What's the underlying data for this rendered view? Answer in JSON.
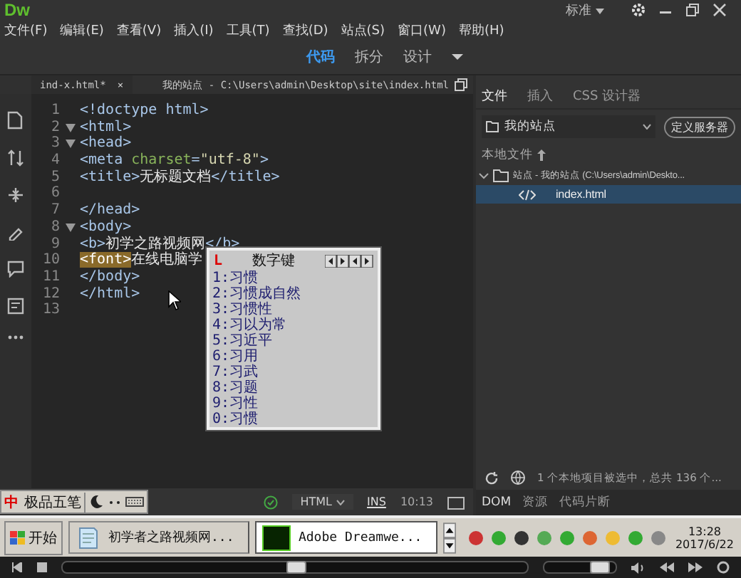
{
  "app": {
    "logo": "Dw",
    "workspace": "标准"
  },
  "menu": [
    "文件(F)",
    "编辑(E)",
    "查看(V)",
    "插入(I)",
    "工具(T)",
    "查找(D)",
    "站点(S)",
    "窗口(W)",
    "帮助(H)"
  ],
  "view_tabs": [
    {
      "label": "代码",
      "selected": true
    },
    {
      "label": "拆分",
      "selected": false
    },
    {
      "label": "设计",
      "selected": false
    }
  ],
  "document": {
    "tab": "ind-x.html*",
    "close": "×",
    "path": "我的站点 - C:\\Users\\admin\\Desktop\\site\\index.html"
  },
  "code_lines": [
    {
      "number": "1",
      "fold": false,
      "tokens": [
        {
          "kind": "tag",
          "text": "<!doctype html>"
        }
      ]
    },
    {
      "number": "2",
      "fold": true,
      "tokens": [
        {
          "kind": "tag",
          "text": "<html>"
        }
      ]
    },
    {
      "number": "3",
      "fold": true,
      "tokens": [
        {
          "kind": "tag",
          "text": "<head>"
        }
      ]
    },
    {
      "number": "4",
      "fold": false,
      "tokens": [
        {
          "kind": "tag",
          "text": "<meta "
        },
        {
          "kind": "attr",
          "text": "charset"
        },
        {
          "kind": "tag",
          "text": "="
        },
        {
          "kind": "string",
          "text": "\"utf-8\""
        },
        {
          "kind": "tag",
          "text": ">"
        }
      ]
    },
    {
      "number": "5",
      "fold": false,
      "tokens": [
        {
          "kind": "tag",
          "text": "<title>"
        },
        {
          "kind": "text",
          "text": "无标题文档"
        },
        {
          "kind": "tag",
          "text": "</title>"
        }
      ]
    },
    {
      "number": "6",
      "fold": false
    },
    {
      "number": "7",
      "fold": false,
      "tokens": [
        {
          "kind": "tag",
          "text": "</head>"
        }
      ]
    },
    {
      "number": "8",
      "fold": true,
      "tokens": [
        {
          "kind": "tag",
          "text": "<body>"
        }
      ]
    },
    {
      "number": "9",
      "fold": false,
      "tokens": [
        {
          "kind": "tag",
          "text": "<b>"
        },
        {
          "kind": "text",
          "text": "初学之路视频网"
        },
        {
          "kind": "tag",
          "text": "</b>"
        }
      ]
    },
    {
      "number": "10",
      "fold": false,
      "tokens": [
        {
          "kind": "match",
          "text": "<font>"
        },
        {
          "kind": "text",
          "text": "在线电脑学"
        }
      ]
    },
    {
      "number": "11",
      "fold": false,
      "tokens": [
        {
          "kind": "tag",
          "text": "</body>"
        }
      ]
    },
    {
      "number": "12",
      "fold": false,
      "tokens": [
        {
          "kind": "tag",
          "text": "</html>"
        }
      ]
    },
    {
      "number": "13",
      "fold": false
    }
  ],
  "ime_candidates": {
    "logo": "L",
    "title": "数字键",
    "items": [
      "1:习惯",
      "2:习惯成自然",
      "3:习惯性",
      "4:习以为常",
      "5:习近平",
      "6:习用",
      "7:习武",
      "8:习题",
      "9:习性",
      "0:习惯"
    ]
  },
  "files_panel": {
    "tabs": [
      {
        "label": "文件",
        "selected": true
      },
      {
        "label": "插入",
        "selected": false
      },
      {
        "label": "CSS 设计器",
        "selected": false
      }
    ],
    "site": "我的站点",
    "define_server": "定义服务器",
    "local_files": "本地文件",
    "tree": [
      {
        "label": "站点 - 我的站点 (C:\\Users\\admin\\Deskto...",
        "expanded": true,
        "selected": false,
        "children": [
          {
            "label": "index.html",
            "selected": true
          }
        ]
      }
    ],
    "status": "1 个本地项目被选中，总共 136 个...",
    "bottom_tabs": [
      {
        "label": "DOM",
        "selected": true
      },
      {
        "label": "资源",
        "selected": false
      },
      {
        "label": "代码片断",
        "selected": false
      }
    ]
  },
  "ime_bar": {
    "mark": "中",
    "name": "极品五笔"
  },
  "status_bar": {
    "language": "HTML",
    "mode": "INS",
    "position": "10:13"
  },
  "taskbar": {
    "start": "开始",
    "tasks": [
      {
        "label": "初学者之路视频网...",
        "kind": "notepad",
        "selected": false
      },
      {
        "label": "Adobe Dreamwe...",
        "kind": "dw",
        "selected": true
      }
    ],
    "time": "13:28",
    "date": "2017/6/22"
  },
  "player": {
    "seek": {
      "level": 0.5
    },
    "volume": {
      "level": 0.75
    }
  }
}
